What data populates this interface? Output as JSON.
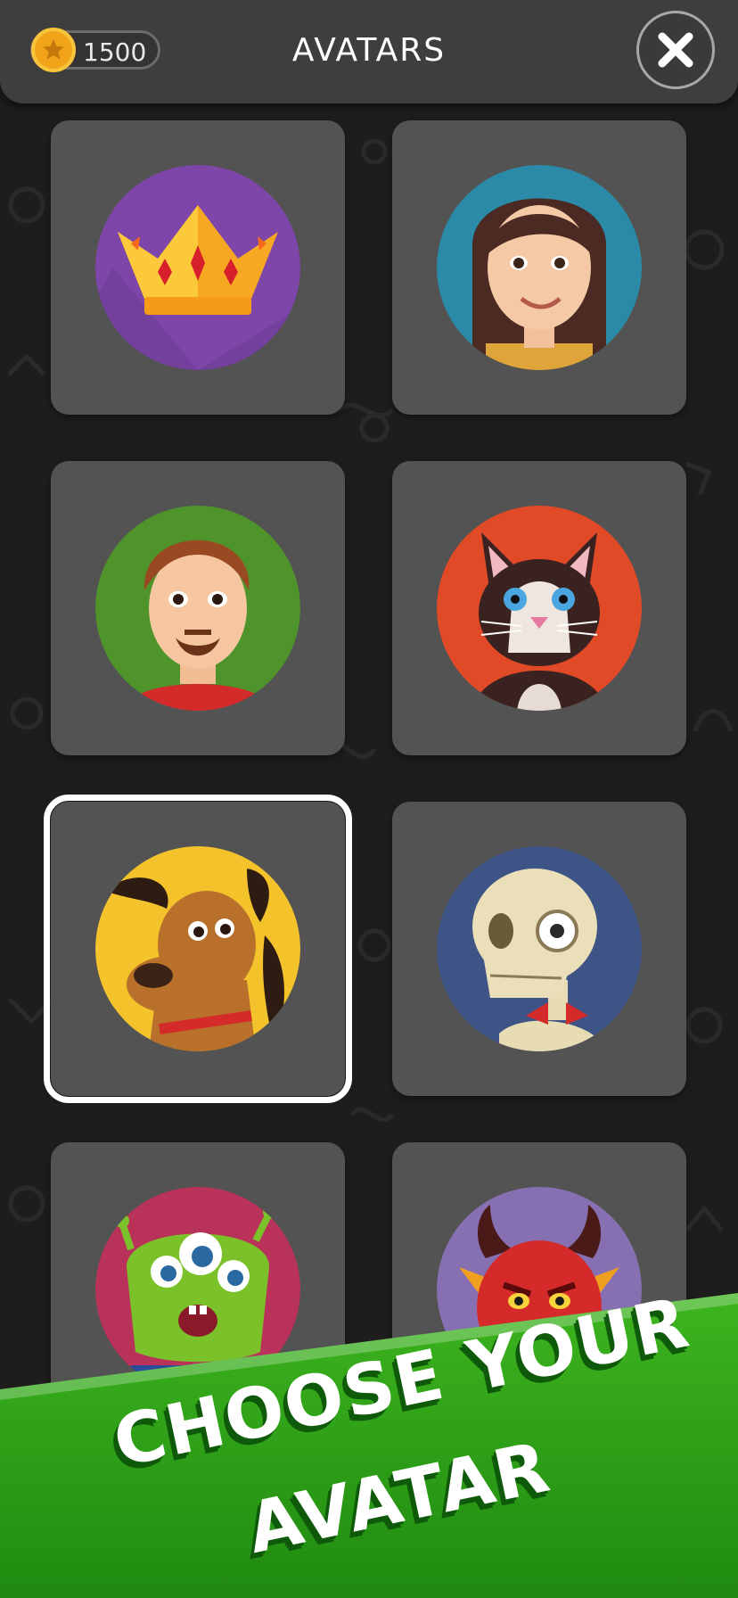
{
  "header": {
    "title": "AVATARS",
    "coins": "1500",
    "coin_icon": "coin-star-icon",
    "close_icon": "close-icon"
  },
  "avatars": [
    {
      "id": "crown",
      "bg": "#7e46a8",
      "selected": false
    },
    {
      "id": "woman",
      "bg": "#2b8aa8",
      "selected": false
    },
    {
      "id": "man",
      "bg": "#4f932b",
      "selected": false
    },
    {
      "id": "cat",
      "bg": "#e14a26",
      "selected": false
    },
    {
      "id": "dog",
      "bg": "#f4c32c",
      "selected": true
    },
    {
      "id": "skull",
      "bg": "#3e5486",
      "selected": false
    },
    {
      "id": "alien",
      "bg": "#b8325a",
      "selected": false
    },
    {
      "id": "devil",
      "bg": "#8670b2",
      "selected": false
    }
  ],
  "banner": {
    "line1": "CHOOSE YOUR",
    "line2": "AVATAR",
    "color": "#2a9a17"
  }
}
